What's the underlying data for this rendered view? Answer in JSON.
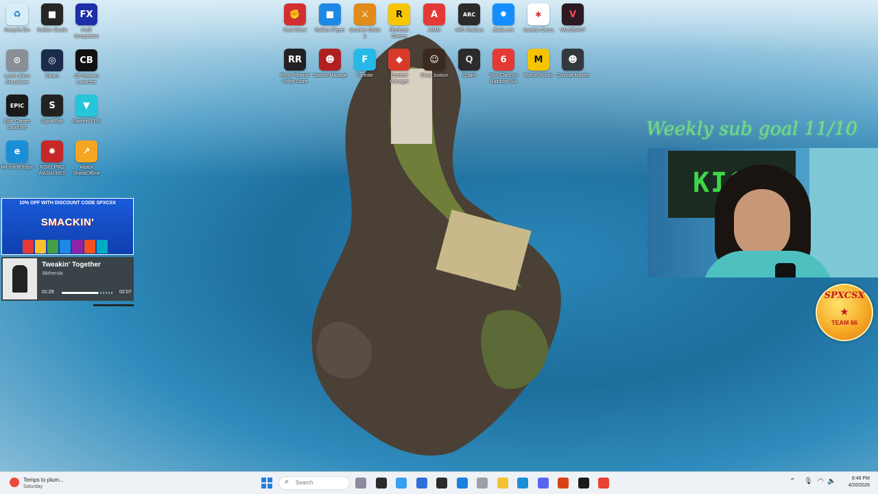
{
  "desktop": {
    "icons": [
      {
        "label": "Recycle Bin",
        "glyph": "♻",
        "color": "#d7eef8",
        "fg": "#2b7bbf",
        "icon": "recycle-bin-icon"
      },
      {
        "label": "Roblox Studio",
        "glyph": "■",
        "color": "#262626",
        "fg": "#ffffff",
        "icon": "roblox-studio-icon"
      },
      {
        "label": "HUD Companion",
        "glyph": "FX",
        "color": "#1e2fa8",
        "fg": "#ffffff",
        "icon": "hud-companion-icon"
      },
      {
        "label": "Learn about this picture",
        "glyph": "⊙",
        "color": "#8a8f96",
        "fg": "#ffffff",
        "icon": "learn-picture-icon"
      },
      {
        "label": "Steam",
        "glyph": "◎",
        "color": "#1b2b4c",
        "fg": "#ffffff",
        "icon": "steam-icon"
      },
      {
        "label": "CB Servers Launcher",
        "glyph": "CB",
        "color": "#111111",
        "fg": "#ffffff",
        "icon": "cb-launcher-icon"
      },
      {
        "label": "Epic Games Launcher",
        "glyph": "EPIC",
        "color": "#1a1a1a",
        "fg": "#ffffff",
        "icon": "epic-games-icon"
      },
      {
        "label": "SignalRgb",
        "glyph": "S",
        "color": "#222222",
        "fg": "#ffffff",
        "icon": "signalrgb-icon"
      },
      {
        "label": "Radmin VPN",
        "glyph": "▼",
        "color": "#26c6da",
        "fg": "#ffffff",
        "icon": "radmin-vpn-icon"
      },
      {
        "label": "Microsoft Edge",
        "glyph": "e",
        "color": "#1a8fd8",
        "fg": "#ffffff",
        "icon": "edge-icon"
      },
      {
        "label": "RSX2 PRO WASHDRES",
        "glyph": "✸",
        "color": "#c62828",
        "fg": "#ffffff",
        "icon": "rsx-icon"
      },
      {
        "label": "Attack ShieldOffline",
        "glyph": "↗",
        "color": "#f4a623",
        "fg": "#ffffff",
        "icon": "attack-shield-icon"
      },
      {
        "label": "Fast Client",
        "glyph": "✊",
        "color": "#d32f2f",
        "fg": "#ffffff",
        "icon": "fast-client-icon"
      },
      {
        "label": "Roblox Player",
        "glyph": "■",
        "color": "#1e88e5",
        "fg": "#ffffff",
        "icon": "roblox-player-icon"
      },
      {
        "label": "Counter-Strike 2",
        "glyph": "⚔",
        "color": "#e08b1a",
        "fg": "#ffffff",
        "icon": "counter-strike-icon"
      },
      {
        "label": "Rockstar Games",
        "glyph": "R",
        "color": "#f7c600",
        "fg": "#111111",
        "icon": "rockstar-icon"
      },
      {
        "label": "AIMM",
        "glyph": "A",
        "color": "#e53935",
        "fg": "#ffffff",
        "icon": "aimm-icon"
      },
      {
        "label": "ARC Raiders",
        "glyph": "ARC",
        "color": "#2b2b2b",
        "fg": "#ffffff",
        "icon": "arc-raiders-icon"
      },
      {
        "label": "Battle.net",
        "glyph": "✸",
        "color": "#148eff",
        "fg": "#ffffff",
        "icon": "battle-net-icon"
      },
      {
        "label": "Assetto Corsa",
        "glyph": "∗",
        "color": "#ffffff",
        "fg": "#c62828",
        "icon": "assetto-corsa-icon"
      },
      {
        "label": "VALORANT",
        "glyph": "V",
        "color": "#2b1a22",
        "fg": "#ff4655",
        "icon": "valorant-icon"
      },
      {
        "label": "Retro Rewind Video Store",
        "glyph": "RR",
        "color": "#222222",
        "fg": "#ffffff",
        "icon": "retro-rewind-icon"
      },
      {
        "label": "Start to Manage",
        "glyph": "☻",
        "color": "#b02020",
        "fg": "#ffffff",
        "icon": "start-manage-icon"
      },
      {
        "label": "Fortnite",
        "glyph": "F",
        "color": "#26b9e8",
        "fg": "#ffffff",
        "icon": "fortnite-icon"
      },
      {
        "label": "Content Manager",
        "glyph": "◆",
        "color": "#d83a2a",
        "fg": "#ffffff",
        "icon": "content-manager-icon"
      },
      {
        "label": "Story Justice",
        "glyph": "☺",
        "color": "#3a2a20",
        "fg": "#ffffff",
        "icon": "story-justice-icon"
      },
      {
        "label": "Quake",
        "glyph": "Q",
        "color": "#2b2b2b",
        "fg": "#d8d8d8",
        "icon": "quake-icon"
      },
      {
        "label": "Tom Clancy's Rainbow Six",
        "glyph": "6",
        "color": "#e53935",
        "fg": "#ffffff",
        "icon": "rainbow-six-icon"
      },
      {
        "label": "Marvel Rivals",
        "glyph": "M",
        "color": "#f4c400",
        "fg": "#111111",
        "icon": "marvel-rivals-icon"
      },
      {
        "label": "Combat Master",
        "glyph": "☻",
        "color": "#33383d",
        "fg": "#ffffff",
        "icon": "combat-master-icon"
      }
    ]
  },
  "promo": {
    "top_text": "10% OFF WITH DISCOUNT CODE SPXCSX",
    "brand": "SMACKIN'"
  },
  "music": {
    "title": "Tweakin' Together",
    "artist": "Bktherula",
    "elapsed": "01:29",
    "total": "02:07",
    "progress": 0.7
  },
  "overlay": {
    "goal_text": "Weekly sub goal 11/10",
    "banner_text": "KICK",
    "badge_top": "SPXCSX",
    "badge_bottom": "TEAM 66"
  },
  "taskbar": {
    "weather_text": "Temps to plum...",
    "weather_sub": "Saturday",
    "search_placeholder": "Search",
    "apps": [
      {
        "name": "task-view-icon",
        "color": "#8d8a9e"
      },
      {
        "name": "widgets-icon",
        "color": "#2c2c2c"
      },
      {
        "name": "copilot-icon",
        "color": "#39a0f0"
      },
      {
        "name": "store-icon",
        "color": "#2f6fd8"
      },
      {
        "name": "app-icon",
        "color": "#2b2b2b"
      },
      {
        "name": "mail-icon",
        "color": "#1a7fe0"
      },
      {
        "name": "shield-icon",
        "color": "#9aa0a6"
      },
      {
        "name": "file-explorer-icon",
        "color": "#f2c230"
      },
      {
        "name": "edge-taskbar-icon",
        "color": "#1a8fd8"
      },
      {
        "name": "discord-icon",
        "color": "#5865f2"
      },
      {
        "name": "recorder-icon",
        "color": "#d84315"
      },
      {
        "name": "epic-taskbar-icon",
        "color": "#1a1a1a"
      },
      {
        "name": "chrome-icon",
        "color": "#e84135"
      }
    ],
    "time": "8:48 PM",
    "date": "4/20/2026"
  }
}
